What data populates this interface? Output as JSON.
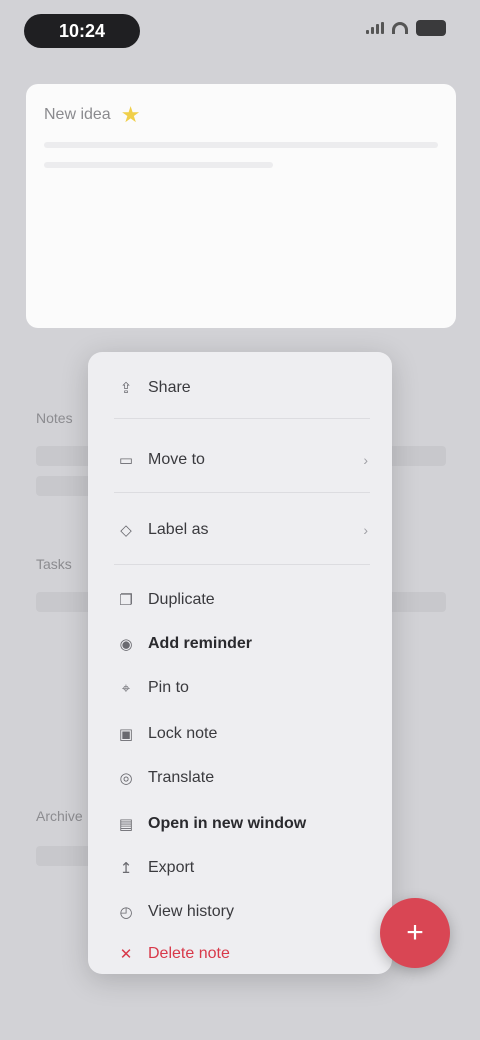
{
  "status_bar": {
    "time": "10:24"
  },
  "note": {
    "title": "New idea",
    "star_icon": "star-icon"
  },
  "background": {
    "section_1": "Notes",
    "section_2": "Tasks",
    "section_3": "Archive"
  },
  "menu": {
    "items": [
      {
        "label": "Share",
        "icon": "share-icon"
      },
      {
        "label": "Move to",
        "icon": "folder-icon"
      },
      {
        "label": "Label as",
        "icon": "tag-icon"
      },
      {
        "label": "Duplicate",
        "icon": "copy-icon"
      },
      {
        "label": "Add reminder",
        "icon": "bell-icon"
      },
      {
        "label": "Pin to",
        "icon": "pin-icon"
      },
      {
        "label": "Lock note",
        "icon": "lock-icon"
      },
      {
        "label": "Translate",
        "icon": "globe-icon"
      },
      {
        "label": "Open in new window",
        "icon": "window-icon"
      },
      {
        "label": "Export",
        "icon": "export-icon"
      },
      {
        "label": "View history",
        "icon": "history-icon"
      },
      {
        "label": "Delete note",
        "icon": "trash-icon"
      }
    ]
  },
  "fab": {
    "icon": "plus-icon",
    "label": "+"
  },
  "colors": {
    "accent": "#d94654",
    "star": "#f0cf4a",
    "menu_bg": "#eeeef1"
  }
}
